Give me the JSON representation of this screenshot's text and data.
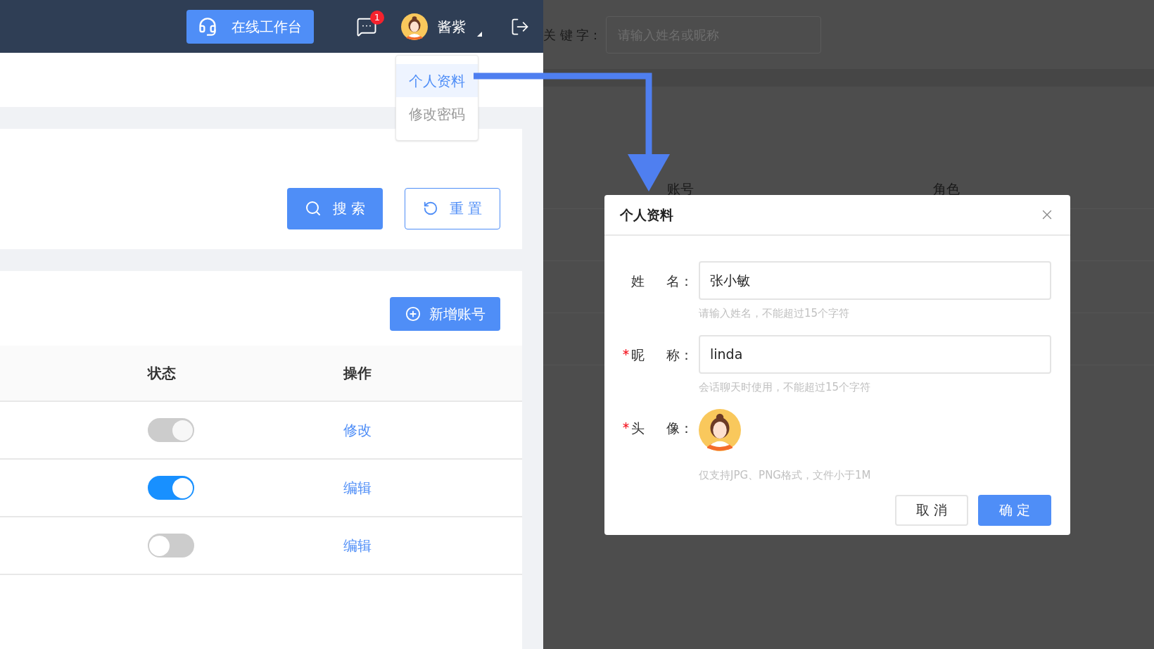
{
  "header": {
    "workbench_button": "在线工作台",
    "messages_badge": "1",
    "user_name": "酱紫"
  },
  "user_menu": {
    "items": [
      {
        "label": "个人资料",
        "selected": true
      },
      {
        "label": "修改密码",
        "selected": false
      }
    ]
  },
  "search_buttons": [
    {
      "label": "搜 索",
      "kind": "primary"
    },
    {
      "label": "重 置",
      "kind": "outline"
    }
  ],
  "add_button": "新增账号",
  "table": {
    "columns": [
      "状态",
      "操作"
    ],
    "rows": [
      {
        "on": true,
        "disabled": true,
        "action": "修改"
      },
      {
        "on": true,
        "disabled": false,
        "action": "编辑"
      },
      {
        "on": false,
        "disabled": false,
        "action": "编辑"
      }
    ]
  },
  "background_page": {
    "keyword_label": "关 键 字：",
    "keyword_placeholder": "请输入姓名或昵称",
    "columns": [
      "账号",
      "角色"
    ]
  },
  "dialog": {
    "title": "个人资料",
    "fields": [
      {
        "kind": "text",
        "label": "姓 名：",
        "required": false,
        "value": "张小敏",
        "hint": "请输入姓名，不能超过15个字符"
      },
      {
        "kind": "text",
        "label": "昵 称：",
        "required": true,
        "value": "linda",
        "hint": "会话聊天时使用，不能超过15个字符"
      },
      {
        "kind": "avatar",
        "label": "头 像：",
        "required": true,
        "hint": "仅支持JPG、PNG格式，文件小于1M"
      }
    ],
    "buttons": [
      {
        "label": "取 消",
        "kind": "secondary"
      },
      {
        "label": "确 定",
        "kind": "primary"
      }
    ]
  }
}
